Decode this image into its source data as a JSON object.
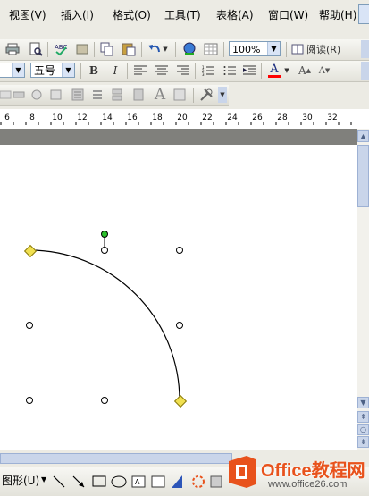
{
  "menubar": {
    "items": [
      "视图(V)",
      "插入(I)",
      "格式(O)",
      "工具(T)",
      "表格(A)",
      "窗口(W)",
      "帮助(H)"
    ]
  },
  "toolbar_standard": {
    "zoom_value": "100%",
    "reading_label": "阅读(R)"
  },
  "toolbar_format": {
    "font_size_value": "五号",
    "bold_label": "B",
    "italic_label": "I",
    "font_color_label": "A",
    "grow_font_label": "A"
  },
  "toolbar_drawing_top": {
    "text_label": "A"
  },
  "ruler": {
    "labels": [
      "6",
      "8",
      "10",
      "12",
      "14",
      "16",
      "18",
      "20",
      "22",
      "24",
      "26",
      "28",
      "30",
      "32"
    ]
  },
  "drawbar": {
    "shapes_label": "图形(U)"
  },
  "watermark": {
    "brand": "Office教程网",
    "url": "www.office26.com"
  },
  "colors": {
    "font_color": "#ff0000",
    "handle_yellow": "#f0e050",
    "rotate_green": "#2bbf2b",
    "logo_orange": "#e8521c"
  }
}
